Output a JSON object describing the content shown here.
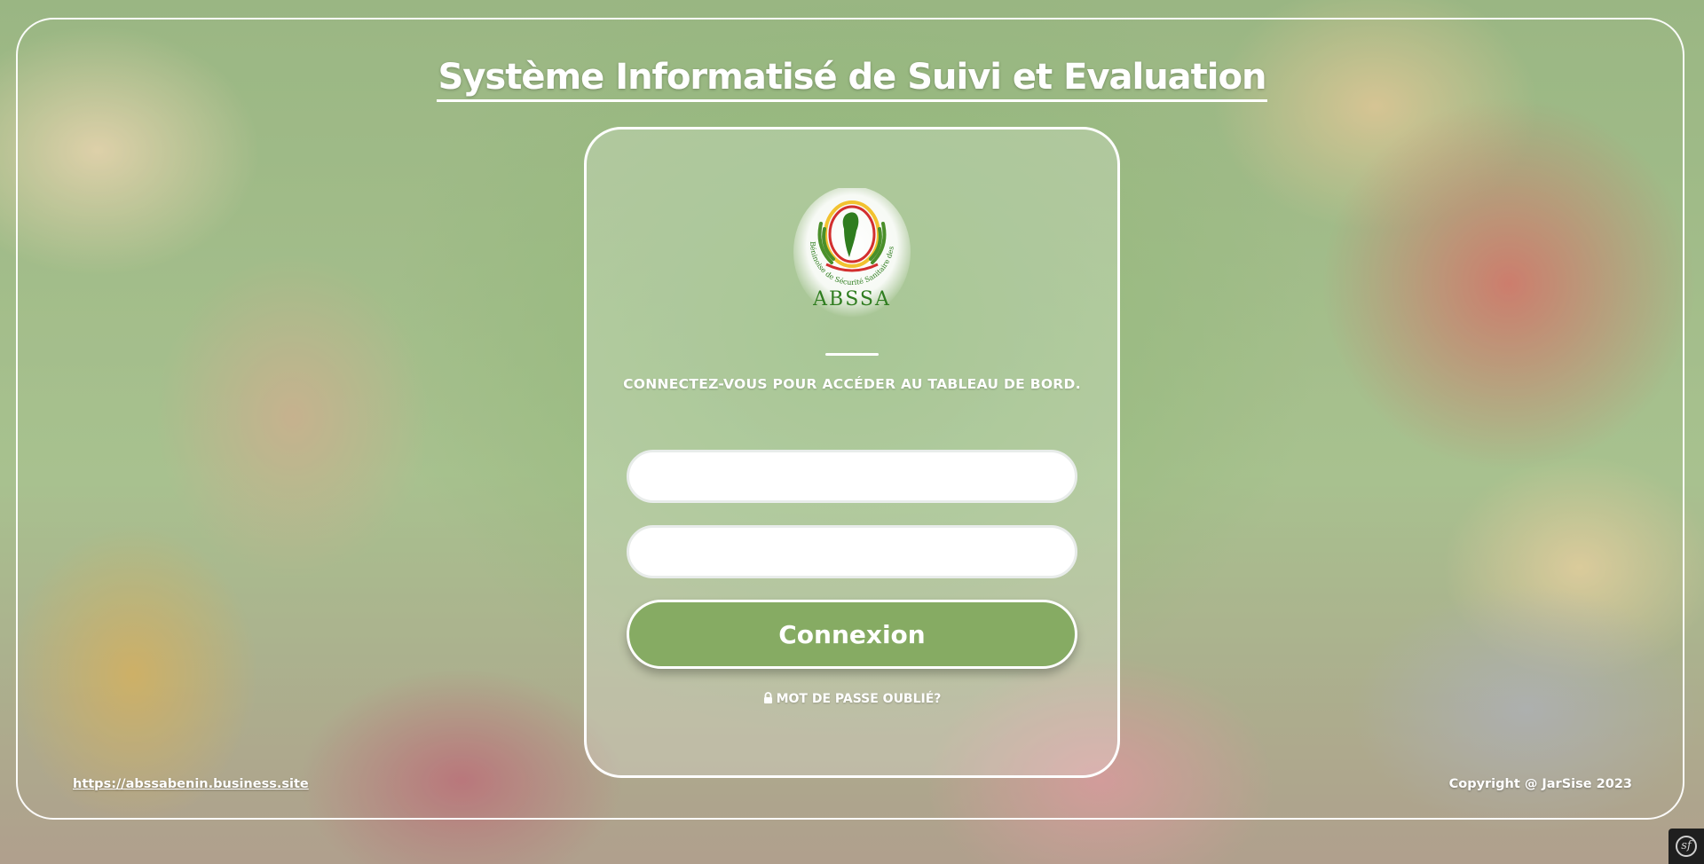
{
  "title": "Système Informatisé de Suivi et Evaluation",
  "login": {
    "subtitle": "CONNECTEZ-VOUS POUR ACCÉDER AU TABLEAU DE BORD.",
    "username_value": "",
    "password_value": "",
    "button_label": "Connexion",
    "forgot_label": "MOT DE PASSE OUBLIÉ?"
  },
  "logo": {
    "text": "ABSSA",
    "arc_text": "Agence Béninoise de Sécurité Sanitaire des Aliments"
  },
  "footer": {
    "link": "https://abssabenin.business.site",
    "copyright": "Copyright @ JarSise 2023"
  },
  "corner_badge": {
    "glyph": "sf"
  },
  "colors": {
    "accent": "#86ab63",
    "logo_green": "#2f7d1f",
    "logo_red": "#d32f2f",
    "logo_yellow": "#f2c230"
  }
}
